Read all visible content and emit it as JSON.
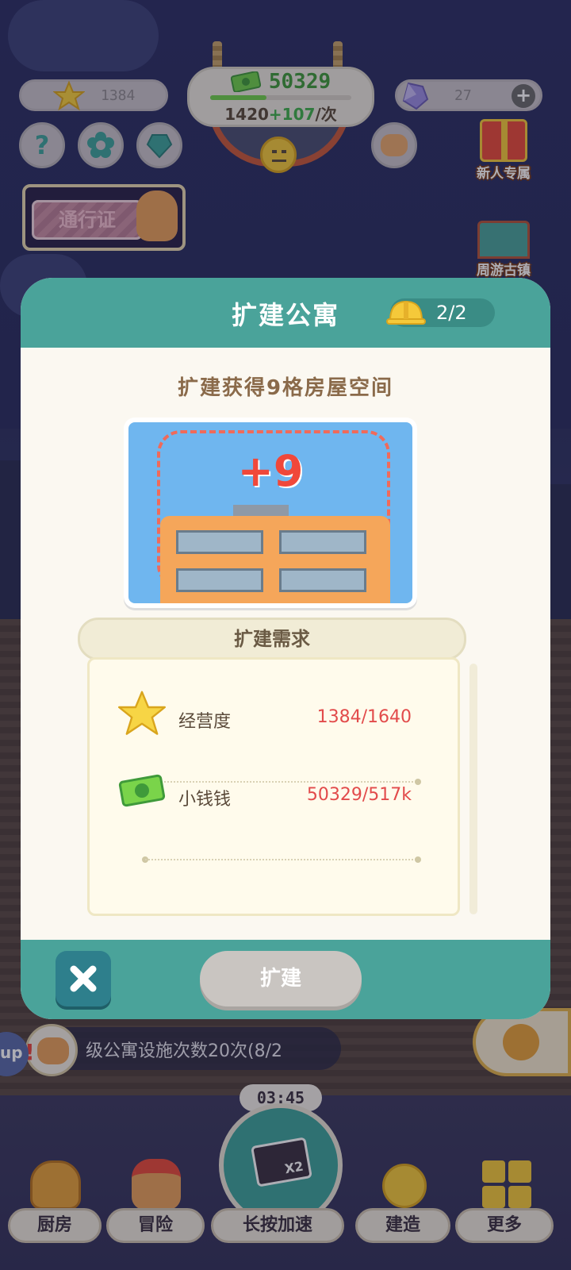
{
  "hud": {
    "stars": "1384",
    "money": "50329",
    "income": "1420",
    "income_bonus": "+107",
    "income_unit": "/次",
    "gems": "27"
  },
  "side_buttons": {
    "pass_label": "通行证",
    "newbie_label": "新人专属",
    "town_label": "周游古镇"
  },
  "modal": {
    "title": "扩建公寓",
    "helmet_count": "2/2",
    "subtitle": "扩建获得9格房屋空间",
    "preview_bonus": "+9",
    "requirements_title": "扩建需求",
    "requirements": [
      {
        "name": "经营度",
        "value": "1384/1640"
      },
      {
        "name": "小钱钱",
        "value": "50329/517k"
      }
    ],
    "expand_label": "扩建"
  },
  "task": {
    "text": "级公寓设施次数20次(8/2",
    "up_label": "up"
  },
  "nav": {
    "kitchen": "厨房",
    "adventure": "冒险",
    "speed": "长按加速",
    "build": "建造",
    "more": "更多",
    "timer": "03:45",
    "speed_multiplier": "X2"
  },
  "colors": {
    "teal": "#4aa39a",
    "red_value": "#e24b4b",
    "money_green": "#3f9a3a",
    "bonus_green": "#3fb04a"
  }
}
